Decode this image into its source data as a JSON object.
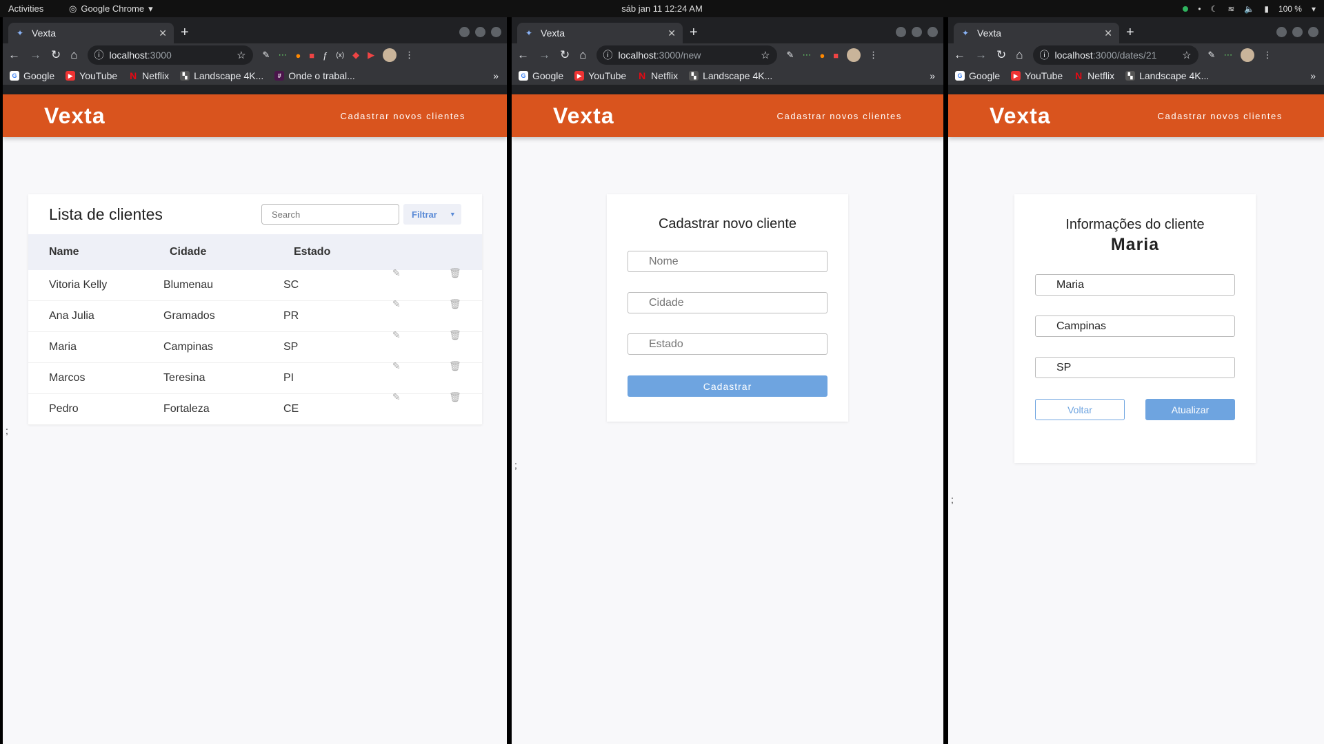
{
  "topbar": {
    "activities": "Activities",
    "app": "Google Chrome",
    "clock": "sáb jan 11  12:24 AM",
    "battery": "100 %"
  },
  "browser": {
    "tab_title": "Vexta",
    "bookmarks": [
      "Google",
      "YouTube",
      "Netflix",
      "Landscape 4K...",
      "Onde o trabal..."
    ]
  },
  "windows": {
    "w1": {
      "url_host": "localhost",
      "url_path": ":3000"
    },
    "w2": {
      "url_host": "localhost",
      "url_path": ":3000/new"
    },
    "w3": {
      "url_host": "localhost",
      "url_path": ":3000/dates/21"
    }
  },
  "site": {
    "brand": "Vexta",
    "nav_link": "Cadastrar novos clientes",
    "stray": ";"
  },
  "list": {
    "title": "Lista de clientes",
    "search_placeholder": "Search",
    "filter_label": "Filtrar",
    "headers": {
      "name": "Name",
      "city": "Cidade",
      "state": "Estado"
    },
    "rows": [
      {
        "name": "Vitoria Kelly",
        "city": "Blumenau",
        "state": "SC"
      },
      {
        "name": "Ana Julia",
        "city": "Gramados",
        "state": "PR"
      },
      {
        "name": "Maria",
        "city": "Campinas",
        "state": "SP"
      },
      {
        "name": "Marcos",
        "city": "Teresina",
        "state": "PI"
      },
      {
        "name": "Pedro",
        "city": "Fortaleza",
        "state": "CE"
      }
    ]
  },
  "new_form": {
    "title": "Cadastrar novo cliente",
    "name_placeholder": "Nome",
    "city_placeholder": "Cidade",
    "state_placeholder": "Estado",
    "submit": "Cadastrar"
  },
  "info_form": {
    "title": "Informações do cliente",
    "client_name": "Maria",
    "name_value": "Maria",
    "city_value": "Campinas",
    "state_value": "SP",
    "back": "Voltar",
    "update": "Atualizar"
  },
  "colors": {
    "brand_orange": "#d9541e",
    "accent_blue": "#6ea4e0"
  }
}
